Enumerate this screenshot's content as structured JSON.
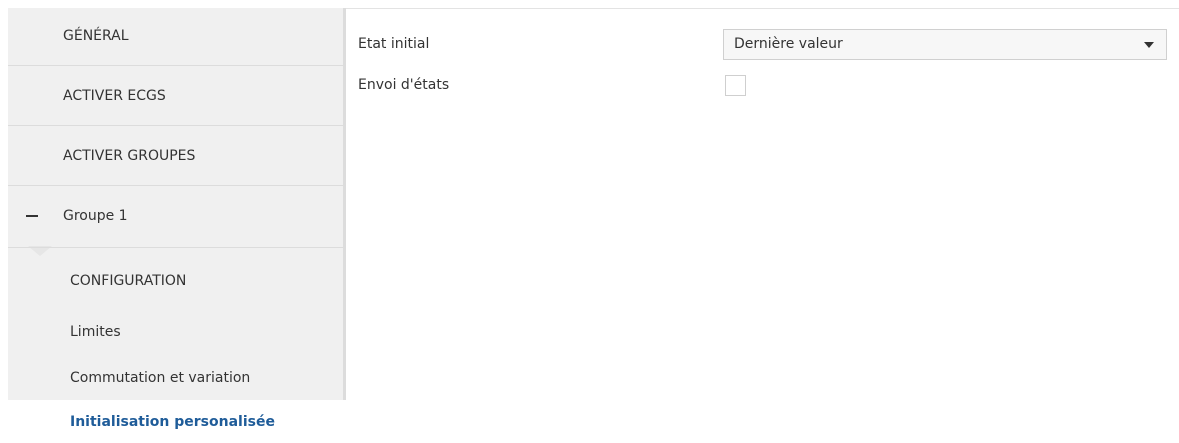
{
  "sidebar": {
    "items": [
      {
        "label": "GÉNÉRAL"
      },
      {
        "label": "ACTIVER ECGS"
      },
      {
        "label": "ACTIVER GROUPES"
      }
    ],
    "group": {
      "label": "Groupe 1",
      "toggle_icon": "minus-icon",
      "children": [
        {
          "label": "CONFIGURATION"
        },
        {
          "label": "Limites"
        },
        {
          "label": "Commutation et variation"
        },
        {
          "label": "Initialisation personalisée",
          "active": true
        }
      ]
    },
    "active_color": "#1f5c99"
  },
  "form": {
    "initial_state": {
      "label": "Etat initial",
      "value": "Dernière valeur"
    },
    "send_states": {
      "label": "Envoi d'états",
      "checked": false
    }
  }
}
